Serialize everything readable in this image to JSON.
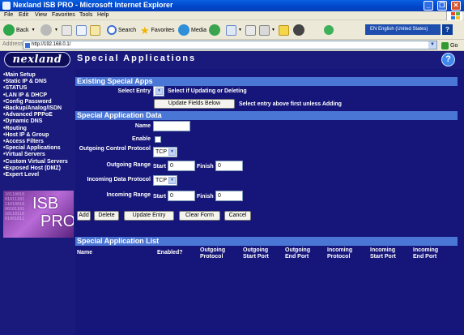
{
  "window": {
    "title": "Nexland ISB PRO - Microsoft Internet Explorer",
    "minimize": "_",
    "maximize": "❐",
    "close": "✕"
  },
  "menu": [
    "File",
    "Edit",
    "View",
    "Favorites",
    "Tools",
    "Help"
  ],
  "toolbar": {
    "back": "Back",
    "search": "Search",
    "favorites": "Favorites",
    "media": "Media",
    "language": "EN English (United States)",
    "help": "?"
  },
  "address": {
    "label": "Address",
    "url": "http://192.168.0.1/",
    "go": "Go"
  },
  "header": {
    "logo": "nexland",
    "title": "Special Applications",
    "help": "?"
  },
  "sidebar": {
    "items": [
      "Main Setup",
      "Static IP & DNS",
      "STATUS",
      "LAN IP & DHCP",
      "Config Password",
      "Backup/Analog/ISDN",
      "Advanced PPPoE",
      "Dynamic DNS",
      "Routing",
      "Host IP & Group",
      "Access Filters",
      "Special Applications",
      "Virtual Servers",
      "Custom Virtual Servers",
      "Exposed Host (DMZ)",
      "Expert Level"
    ],
    "image_text": {
      "isb": "ISB",
      "pro": "PRO",
      "bits": "10110010\n01011101\n11010010\n00101101\n10110110\n01001011"
    }
  },
  "existing": {
    "header": "Existing Special Apps",
    "select_entry_label": "Select Entry",
    "select_entry_value": "",
    "select_hint": "Select if Updating or Deleting",
    "update_fields_button": "Update Fields Below",
    "update_hint": "Select entry above first unless Adding"
  },
  "data": {
    "header": "Special Application Data",
    "name_label": "Name",
    "name_value": "",
    "enable_label": "Enable",
    "outgoing_control_label": "Outgoing Control Protocol",
    "outgoing_control_value": "TCP",
    "outgoing_range_label": "Outgoing Range",
    "start_label": "Start",
    "finish_label": "Finish",
    "outgoing_start": "0",
    "outgoing_finish": "0",
    "incoming_data_label": "Incoming Data Protocol",
    "incoming_data_value": "TCP",
    "incoming_range_label": "Incoming Range",
    "incoming_start": "0",
    "incoming_finish": "0"
  },
  "actions": {
    "add": "Add",
    "delete": "Delete",
    "update_entry": "Update Entry",
    "clear_form": "Clear Form",
    "cancel": "Cancel"
  },
  "list": {
    "header": "Special Application List",
    "columns": [
      "Name",
      "Enabled?",
      "Outgoing Protocol",
      "Outgoing Start Port",
      "Outgoing End Port",
      "Incoming Protocol",
      "Incoming Start Port",
      "Incoming End Port"
    ]
  }
}
